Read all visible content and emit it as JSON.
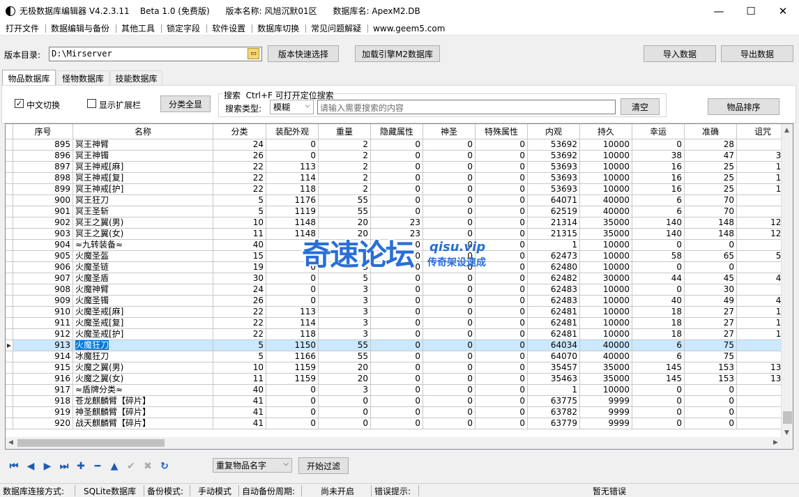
{
  "window": {
    "title": "无极数据库编辑器 V4.2.3.11    Beta 1.0 (免费版)      版本名称: 风旭沉默01区      数据库名: ApexM2.DB",
    "minimize": "—",
    "maximize": "☐",
    "close": "✕"
  },
  "menu": [
    "打开文件",
    "数据编辑与备份",
    "其他工具",
    "锁定字段",
    "软件设置",
    "数据库切换",
    "常见问题解疑",
    "www.geem5.com"
  ],
  "toolbar": {
    "version_dir_label": "版本目录:",
    "version_dir_value": "D:\\Mirserver",
    "version_quick_select": "版本快速选择",
    "load_engine": "加载引擎M2数据库",
    "import": "导入数据",
    "export": "导出数据"
  },
  "tabs": [
    {
      "label": "物品数据库",
      "active": true
    },
    {
      "label": "怪物数据库",
      "active": false
    },
    {
      "label": "技能数据库",
      "active": false
    }
  ],
  "filters": {
    "chinese_switch": "中文切换",
    "chinese_checked": true,
    "show_ext": "显示扩展栏",
    "show_ext_checked": false,
    "show_all": "分类全显",
    "search_title": "搜索  Ctrl+F 可打开定位搜索",
    "search_type_label": "搜索类型:",
    "search_type_value": "模糊",
    "search_placeholder": "请输入需要搜索的内容",
    "clear": "清空",
    "sort": "物品排序"
  },
  "grid": {
    "columns": [
      "序号",
      "名称",
      "分类",
      "装配外观",
      "重量",
      "隐藏属性",
      "神圣",
      "特殊属性",
      "内观",
      "持久",
      "幸运",
      "准确",
      "诅咒"
    ],
    "selected_index": 18,
    "rows": [
      [
        "895",
        "冥王神臂",
        "24",
        "0",
        "2",
        "0",
        "0",
        "0",
        "53692",
        "10000",
        "0",
        "28",
        "0"
      ],
      [
        "896",
        "冥王神镯",
        "26",
        "0",
        "2",
        "0",
        "0",
        "0",
        "53692",
        "10000",
        "38",
        "47",
        "38"
      ],
      [
        "897",
        "冥王神戒[麻]",
        "22",
        "113",
        "2",
        "0",
        "0",
        "0",
        "53693",
        "10000",
        "16",
        "25",
        "17"
      ],
      [
        "898",
        "冥王神戒[复]",
        "22",
        "114",
        "2",
        "0",
        "0",
        "0",
        "53693",
        "10000",
        "16",
        "25",
        "17"
      ],
      [
        "899",
        "冥王神戒[护]",
        "22",
        "118",
        "2",
        "0",
        "0",
        "0",
        "53693",
        "10000",
        "16",
        "25",
        "17"
      ],
      [
        "900",
        "冥王狂刀",
        "5",
        "1176",
        "55",
        "0",
        "0",
        "0",
        "64071",
        "40000",
        "6",
        "70",
        "0"
      ],
      [
        "901",
        "冥王圣斩",
        "5",
        "1119",
        "55",
        "0",
        "0",
        "0",
        "62519",
        "40000",
        "6",
        "70",
        "0"
      ],
      [
        "902",
        "冥王之翼(男)",
        "10",
        "1148",
        "20",
        "23",
        "0",
        "0",
        "21314",
        "35000",
        "140",
        "148",
        "126"
      ],
      [
        "903",
        "冥王之翼(女)",
        "11",
        "1148",
        "20",
        "23",
        "0",
        "0",
        "21315",
        "35000",
        "140",
        "148",
        "126"
      ],
      [
        "904",
        "≈九转装备≈",
        "40",
        "0",
        "3",
        "0",
        "0",
        "0",
        "1",
        "10000",
        "0",
        "0",
        "0"
      ],
      [
        "905",
        "火魔圣盔",
        "15",
        "0",
        "3",
        "0",
        "0",
        "0",
        "62473",
        "10000",
        "58",
        "65",
        "54"
      ],
      [
        "906",
        "火魔圣链",
        "19",
        "0",
        "3",
        "0",
        "0",
        "0",
        "62480",
        "10000",
        "0",
        "0",
        "0"
      ],
      [
        "907",
        "火魔圣盾",
        "30",
        "0",
        "5",
        "0",
        "0",
        "0",
        "62482",
        "30000",
        "44",
        "45",
        "44"
      ],
      [
        "908",
        "火魔神臂",
        "24",
        "0",
        "3",
        "0",
        "0",
        "0",
        "62483",
        "10000",
        "0",
        "30",
        "0"
      ],
      [
        "909",
        "火魔圣镯",
        "26",
        "0",
        "3",
        "0",
        "0",
        "0",
        "62483",
        "10000",
        "40",
        "49",
        "40"
      ],
      [
        "910",
        "火魔圣戒[麻]",
        "22",
        "113",
        "3",
        "0",
        "0",
        "0",
        "62481",
        "10000",
        "18",
        "27",
        "19"
      ],
      [
        "911",
        "火魔圣戒[复]",
        "22",
        "114",
        "3",
        "0",
        "0",
        "0",
        "62481",
        "10000",
        "18",
        "27",
        "19"
      ],
      [
        "912",
        "火魔圣戒[护]",
        "22",
        "118",
        "3",
        "0",
        "0",
        "0",
        "62481",
        "10000",
        "18",
        "27",
        "19"
      ],
      [
        "913",
        "火魔狂刀",
        "5",
        "1150",
        "55",
        "0",
        "0",
        "0",
        "64034",
        "40000",
        "6",
        "75",
        "0"
      ],
      [
        "914",
        "冰魔狂刀",
        "5",
        "1166",
        "55",
        "0",
        "0",
        "0",
        "64070",
        "40000",
        "6",
        "75",
        "0"
      ],
      [
        "915",
        "火魔之翼(男)",
        "10",
        "1159",
        "20",
        "0",
        "0",
        "0",
        "35457",
        "35000",
        "145",
        "153",
        "131"
      ],
      [
        "916",
        "火魔之翼(女)",
        "11",
        "1159",
        "20",
        "0",
        "0",
        "0",
        "35463",
        "35000",
        "145",
        "153",
        "131"
      ],
      [
        "917",
        "≈盾牌分类≈",
        "40",
        "0",
        "3",
        "0",
        "0",
        "0",
        "1",
        "10000",
        "0",
        "0",
        "0"
      ],
      [
        "918",
        "苍龙麒麟臂【碎片】",
        "41",
        "0",
        "0",
        "0",
        "0",
        "0",
        "63775",
        "9999",
        "0",
        "0",
        "0"
      ],
      [
        "919",
        "神圣麒麟臂【碎片】",
        "41",
        "0",
        "0",
        "0",
        "0",
        "0",
        "63782",
        "9999",
        "0",
        "0",
        "0"
      ],
      [
        "920",
        "战天麒麟臂【碎片】",
        "41",
        "0",
        "0",
        "0",
        "0",
        "0",
        "63779",
        "9999",
        "0",
        "0",
        "0"
      ]
    ]
  },
  "nav": {
    "icons": [
      "first-icon",
      "prev-icon",
      "next-icon",
      "last-icon",
      "add-icon",
      "delete-icon",
      "up-icon",
      "confirm-icon",
      "cancel-icon",
      "refresh-icon"
    ],
    "filter_combo": "重复物品名字",
    "start_filter": "开始过滤"
  },
  "status": {
    "conn_label": "数据库连接方式:",
    "conn_value": "SQLite数据库",
    "backup_label": "备份模式:",
    "backup_value": "手动模式",
    "auto_label": "自动备份周期:",
    "auto_value": "尚未开启",
    "err_label": "错误提示:",
    "err_value": "暂无错误"
  },
  "watermark": {
    "main": "奇速论坛",
    "site": "qisu.vip",
    "sub": "传奇架设速成"
  }
}
